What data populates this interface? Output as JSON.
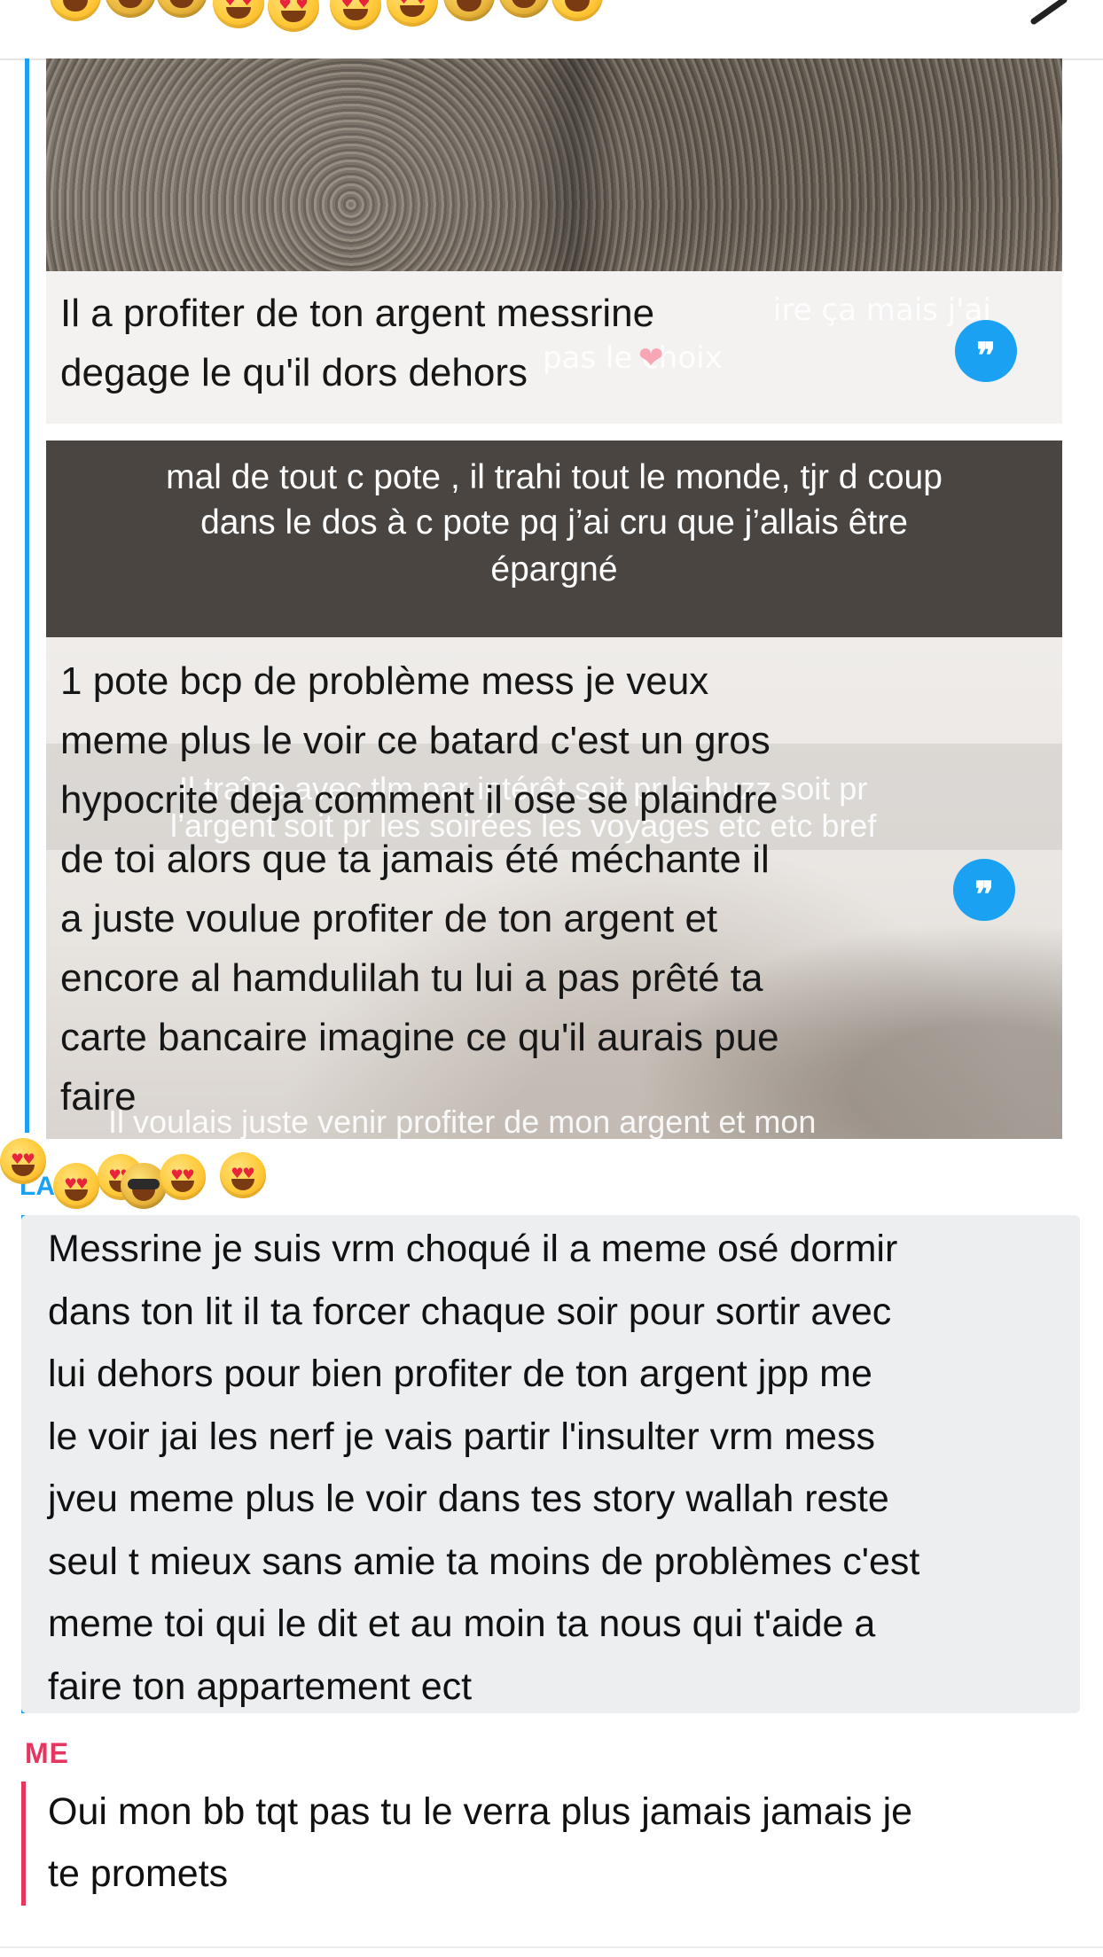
{
  "header": {
    "back_icon": "chevron-icon"
  },
  "snap1": {
    "ghost_caption_a": "ire ça mais j'ai",
    "ghost_caption_b": "pas le choix",
    "reply_lines": [
      "Il a profiter de ton argent messrine",
      "degage le qu'il dors dehors"
    ]
  },
  "snap2": {
    "caption_lines": [
      "mal de tout c pote , il trahi tout le monde, tjr d coup",
      "dans le dos à c pote pq j’ai cru que j’allais être",
      "épargné"
    ]
  },
  "snap3": {
    "ghost_caption_a": "Il traîne avec tlm par intérêt soit pr le buzz soit pr",
    "ghost_caption_b": "l’argent soit pr les soirées les voyages etc etc bref",
    "ghost_caption_c": "Il voulais juste venir profiter de mon argent et mon",
    "reply_lines": [
      "1 pote bcp de problème mess je veux",
      "meme plus le voir ce batard c'est un gros",
      "hypocrite deja comment il ose se plaindre",
      "de toi alors que ta jamais été méchante il",
      "a juste voulue profiter de ton argent et",
      "encore al hamdulilah tu lui a pas prêté ta",
      "carte bancaire imagine ce qu'il aurais pue",
      "faire"
    ]
  },
  "friend_label": "LA",
  "message": {
    "lines": [
      "Messrine je suis vrm choqué il a meme osé dormir",
      "dans ton lit il ta forcer chaque soir pour sortir avec",
      "lui dehors pour bien profiter de ton argent jpp me",
      "le voir jai les nerf je vais partir l'insulter vrm mess",
      "jveu meme plus le voir dans tes story wallah reste",
      "seul t mieux sans amie ta moins de problèmes c'est",
      "meme toi qui le dit et au moin ta nous qui t'aide a",
      "faire ton appartement ect"
    ]
  },
  "me": {
    "sender": "ME",
    "lines": [
      "Oui mon bb tqt pas tu le verra plus jamais jamais je",
      "te promets"
    ]
  },
  "colors": {
    "friend_accent": "#1aa1f2",
    "me_accent": "#e6365f",
    "bubble_bg": "#eceef0"
  }
}
